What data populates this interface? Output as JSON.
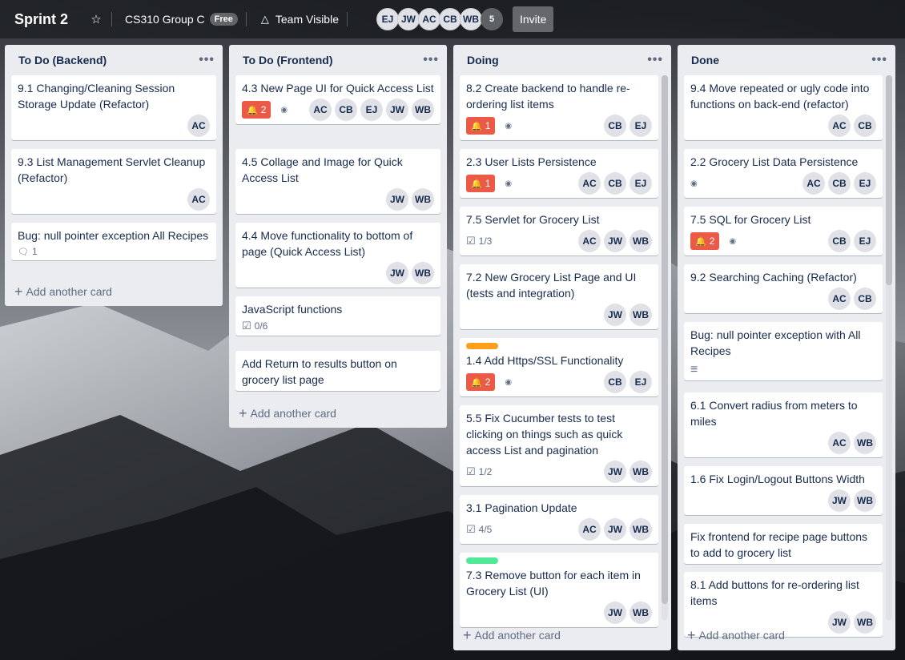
{
  "header": {
    "board_title": "Sprint 2",
    "star_icon": "star-icon",
    "team_name": "CS310 Group C",
    "plan_badge": "Free",
    "visibility_icon": "team-icon",
    "visibility_label": "Team Visible",
    "members": [
      "EJ",
      "JW",
      "AC",
      "CB",
      "WB"
    ],
    "member_count": "5",
    "invite_label": "Invite"
  },
  "lists": [
    {
      "title": "To Do (Backend)",
      "add_card": "Add another card",
      "cards": [
        {
          "title": "9.1 Changing/Cleaning Session Storage Update (Refactor)",
          "members": [
            "AC"
          ]
        },
        {
          "title": "9.3 List Management Servlet Cleanup (Refactor)",
          "members": [
            "AC"
          ]
        },
        {
          "title": "Bug: null pointer exception All Recipes",
          "comments": "1",
          "members": []
        }
      ]
    },
    {
      "title": "To Do (Frontend)",
      "add_card": "Add another card",
      "cards": [
        {
          "title": "4.3 New Page UI for Quick Access List",
          "due": "2",
          "watch": true,
          "members": [
            "AC",
            "CB",
            "EJ",
            "JW",
            "WB"
          ]
        },
        {
          "title": "4.5 Collage and Image for Quick Access List",
          "members": [
            "JW",
            "WB"
          ]
        },
        {
          "title": "4.4 Move functionality to bottom of page (Quick Access List)",
          "members": [
            "JW",
            "WB"
          ]
        },
        {
          "title": "JavaScript functions",
          "checklist": "0/6",
          "members": []
        },
        {
          "title": "Add Return to results button on grocery list page",
          "members": []
        }
      ]
    },
    {
      "title": "Doing",
      "add_card": "Add another card",
      "cards": [
        {
          "title": "8.2 Create backend to handle re-ordering list items",
          "due": "1",
          "watch": true,
          "members": [
            "CB",
            "EJ"
          ]
        },
        {
          "title": "2.3 User Lists Persistence",
          "due": "1",
          "watch": true,
          "members": [
            "AC",
            "CB",
            "EJ"
          ]
        },
        {
          "title": "7.5 Servlet for Grocery List",
          "checklist": "1/3",
          "members": [
            "AC",
            "JW",
            "WB"
          ]
        },
        {
          "title": "7.2 New Grocery List Page and UI (tests and integration)",
          "members": [
            "JW",
            "WB"
          ]
        },
        {
          "title": "1.4 Add Https/SSL Functionality",
          "label_color": "#ff9f1a",
          "due": "2",
          "watch": true,
          "members": [
            "CB",
            "EJ"
          ]
        },
        {
          "title": "5.5 Fix Cucumber tests to test clicking on things such as quick access List and pagination",
          "checklist": "1/2",
          "members": [
            "JW",
            "WB"
          ]
        },
        {
          "title": "3.1 Pagination Update",
          "checklist": "4/5",
          "members": [
            "AC",
            "JW",
            "WB"
          ]
        },
        {
          "title": "7.3 Remove button for each item in Grocery List (UI)",
          "label_color": "#51e898",
          "members": [
            "JW",
            "WB"
          ]
        }
      ]
    },
    {
      "title": "Done",
      "add_card": "Add another card",
      "cards": [
        {
          "title": "9.4 Move repeated or ugly code into functions on back-end (refactor)",
          "members": [
            "AC",
            "CB"
          ]
        },
        {
          "title": "2.2 Grocery List Data Persistence",
          "watch": true,
          "members": [
            "AC",
            "CB",
            "EJ"
          ]
        },
        {
          "title": "7.5 SQL for Grocery List",
          "due": "2",
          "watch": true,
          "members": [
            "CB",
            "EJ"
          ]
        },
        {
          "title": "9.2 Searching Caching (Refactor)",
          "members": [
            "AC",
            "CB"
          ]
        },
        {
          "title": "Bug: null pointer exception with All Recipes",
          "description": true,
          "members": []
        },
        {
          "title": "6.1 Convert radius from meters to miles",
          "members": [
            "AC",
            "WB"
          ]
        },
        {
          "title": "1.6 Fix Login/Logout Buttons Width",
          "members": [
            "JW",
            "WB"
          ]
        },
        {
          "title": "Fix frontend for recipe page buttons to add to grocery list",
          "members": []
        },
        {
          "title": "8.1 Add buttons for re-ordering list items",
          "members": [
            "JW",
            "WB"
          ]
        }
      ]
    }
  ]
}
